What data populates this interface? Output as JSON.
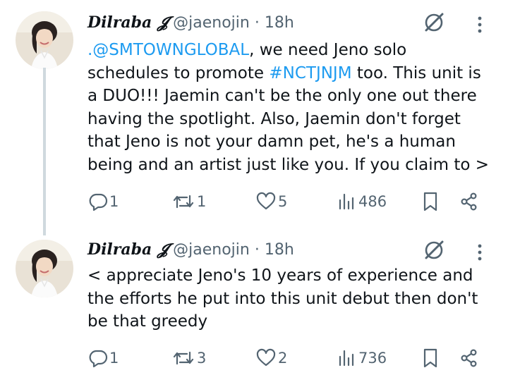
{
  "tweets": [
    {
      "author_name": "Dilraba 𝓙",
      "handle": "@jaenojin",
      "separator": "·",
      "time": "18h",
      "text_parts": {
        "mention": ".@SMTOWNGLOBAL",
        "t1": ", we need Jeno solo\nschedules to promote ",
        "hashtag": "#NCTJNJM",
        "t2": " too. This unit is\na DUO!!! Jaemin can't be the only one out there\nhaving the spotlight. Also, Jaemin don't forget\nthat Jeno is not your damn pet, he's a human\nbeing and an artist just like you. If you claim to >"
      },
      "replies": "1",
      "reposts": "1",
      "likes": "5",
      "views": "486"
    },
    {
      "author_name": "Dilraba 𝓙",
      "handle": "@jaenojin",
      "separator": "·",
      "time": "18h",
      "text": "< appreciate Jeno's 10 years of experience and\nthe efforts he put into this unit debut then don't\nbe that greedy",
      "replies": "1",
      "reposts": "3",
      "likes": "2",
      "views": "736"
    }
  ],
  "icons": {
    "grok": "grok-slash-icon",
    "more": "more-vertical-icon",
    "reply": "reply-bubble-icon",
    "repost": "repost-arrows-icon",
    "like": "heart-icon",
    "views": "views-bars-icon",
    "bookmark": "bookmark-icon",
    "share": "share-nodes-icon"
  },
  "colors": {
    "link": "#1d9bf0",
    "text": "#0f1419",
    "muted": "#536471",
    "thread_line": "#cfd9de"
  }
}
